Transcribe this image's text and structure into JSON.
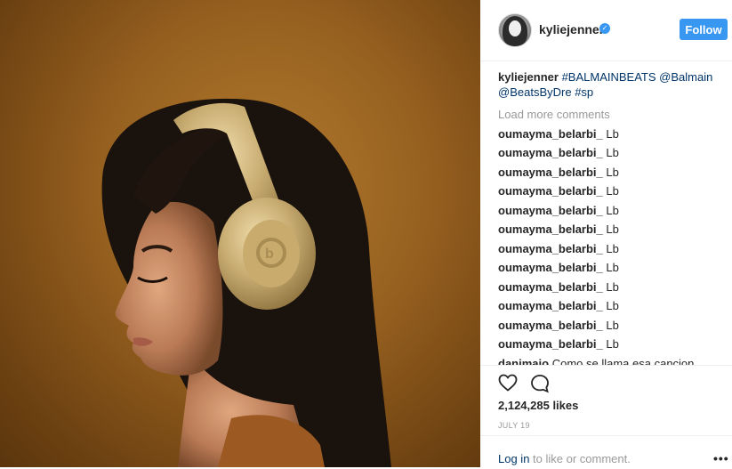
{
  "post": {
    "image_alt": "Kylie Jenner wearing gold Beats headphones"
  },
  "header": {
    "username": "kyliejenner",
    "verified_glyph": "✓",
    "follow_label": "Follow"
  },
  "caption": {
    "author": "kyliejenner",
    "hashtag1": "#BALMAINBEATS",
    "mention1": "@Balmain",
    "mention2": "@BeatsByDre",
    "hashtag2": "#sp"
  },
  "load_more": "Load more comments",
  "comments": [
    {
      "user": "oumayma_belarbi_",
      "text": "Lb"
    },
    {
      "user": "oumayma_belarbi_",
      "text": "Lb"
    },
    {
      "user": "oumayma_belarbi_",
      "text": "Lb"
    },
    {
      "user": "oumayma_belarbi_",
      "text": "Lb"
    },
    {
      "user": "oumayma_belarbi_",
      "text": "Lb"
    },
    {
      "user": "oumayma_belarbi_",
      "text": "Lb"
    },
    {
      "user": "oumayma_belarbi_",
      "text": "Lb"
    },
    {
      "user": "oumayma_belarbi_",
      "text": "Lb"
    },
    {
      "user": "oumayma_belarbi_",
      "text": "Lb"
    },
    {
      "user": "oumayma_belarbi_",
      "text": "Lb"
    },
    {
      "user": "oumayma_belarbi_",
      "text": "Lb"
    },
    {
      "user": "oumayma_belarbi_",
      "text": "Lb"
    },
    {
      "user": "danimaio",
      "text": "Como se llama esa cancion"
    }
  ],
  "actions": {
    "like_icon": "heart-icon",
    "comment_icon": "comment-bubble-icon"
  },
  "likes": "2,124,285 likes",
  "date": "JULY 19",
  "login": {
    "link": "Log in",
    "text": " to like or comment."
  },
  "more_icon": "•••",
  "colors": {
    "accent": "#3897f0",
    "link": "#003569",
    "muted": "#999999",
    "photo_bg": "#955f1f"
  }
}
